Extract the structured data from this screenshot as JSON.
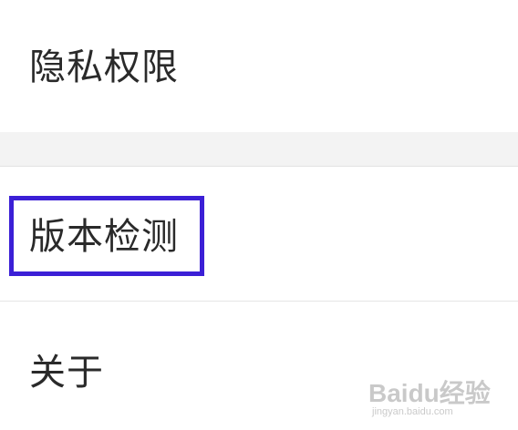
{
  "settings": {
    "items": [
      {
        "label": "隐私权限"
      },
      {
        "label": "版本检测"
      },
      {
        "label": "关于"
      }
    ],
    "highlight_color": "#3b1fd6",
    "section_background": "#f3f3f3"
  },
  "watermark": {
    "logo_text": "Baidu经验",
    "url_text": "jingyan.baidu.com"
  }
}
